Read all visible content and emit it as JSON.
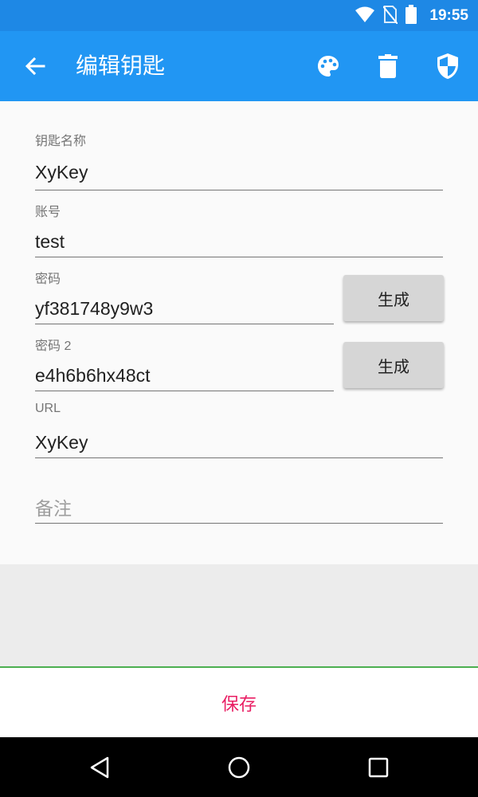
{
  "status_bar": {
    "time": "19:55",
    "icons": [
      "wifi-icon",
      "no-sim-icon",
      "battery-icon"
    ]
  },
  "app_bar": {
    "title": "编辑钥匙",
    "icons": [
      "back-arrow-icon",
      "palette-icon",
      "delete-icon",
      "shield-icon"
    ],
    "background": "#2196f3"
  },
  "form": {
    "key_name": {
      "label": "钥匙名称",
      "value": "XyKey"
    },
    "account": {
      "label": "账号",
      "value": "test"
    },
    "password": {
      "label": "密码",
      "value": "yf381748y9w3",
      "generate_label": "生成"
    },
    "password2": {
      "label": "密码 2",
      "value": "e4h6b6hx48ct",
      "generate_label": "生成"
    },
    "url": {
      "label": "URL",
      "value": "XyKey"
    },
    "note": {
      "placeholder": "备注"
    }
  },
  "actions": {
    "save_label": "保存",
    "save_color": "#e91e63"
  },
  "nav_bar": {
    "icons": [
      "back-triangle-icon",
      "home-circle-icon",
      "recents-square-icon"
    ]
  }
}
